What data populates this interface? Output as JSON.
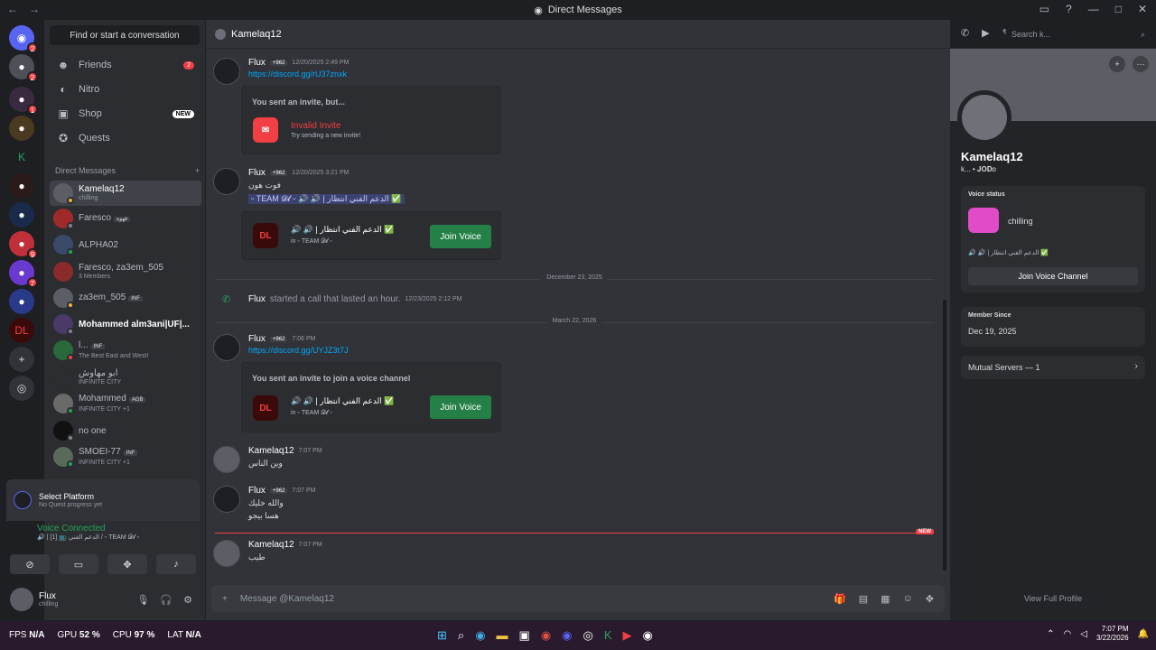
{
  "window": {
    "title": "Direct Messages"
  },
  "sidebar": {
    "find_label": "Find or start a conversation",
    "nav": [
      {
        "label": "Friends",
        "badge": "2"
      },
      {
        "label": "Nitro",
        "badge": ""
      },
      {
        "label": "Shop",
        "badge": "NEW"
      },
      {
        "label": "Quests",
        "badge": ""
      }
    ],
    "dm_header": "Direct Messages",
    "dms": [
      {
        "name": "Kamelaq12",
        "sub": "chilling"
      },
      {
        "name": "Faresco",
        "sub": "",
        "tag": "قهوة"
      },
      {
        "name": "ALPHA02",
        "sub": ""
      },
      {
        "name": "Faresco, za3em_505",
        "sub": "3 Members"
      },
      {
        "name": "za3em_505",
        "sub": "",
        "tag": "INF"
      },
      {
        "name": "Mohammed alm3ani|UF|...",
        "sub": ""
      },
      {
        "name": "l...",
        "sub": "The Best East and West!",
        "tag": "INF"
      },
      {
        "name": "ابو مهاوش",
        "sub": "INFINITE CITY"
      },
      {
        "name": "Mohammed",
        "sub": "INFINITE CITY +1",
        "tag": "AGB"
      },
      {
        "name": "no one",
        "sub": ""
      },
      {
        "name": "SMOEI-77",
        "sub": "INFINITE CITY +1",
        "tag": "INF"
      }
    ],
    "quest": {
      "title": "Select Platform",
      "sub": "No Quest progress yet"
    },
    "voice": {
      "status": "Voice Connected",
      "channel": "🔊 | [1] 📺 الدعم الفني / ᵕ TEAM 𝓓𝓵 ᵕ"
    },
    "user": {
      "name": "Flux",
      "status": "chilling"
    }
  },
  "chat": {
    "recipient": "Kamelaq12",
    "search_placeholder": "Search k...",
    "composer_placeholder": "Message @Kamelaq12",
    "messages": [
      {
        "author": "Flux",
        "badge": "+962",
        "time": "12/20/2025 2:49 PM",
        "link": "https://discord.gg/rU37znxk"
      },
      {
        "author": "Flux",
        "badge": "+962",
        "time": "12/20/2025 3:21 PM",
        "text": "فوت هون",
        "mention": "ᵕ TEAM 𝓓𝓵 ᵕ 🔊 🔊 | الدعم الفني انتظار ✅"
      },
      {
        "author": "Flux",
        "badge": "+962",
        "time": "7:06 PM",
        "link": "https://discord.gg/UYJZ3t7J"
      },
      {
        "author": "Kamelaq12",
        "time": "7:07 PM",
        "text": "وين الناس"
      },
      {
        "author": "Flux",
        "badge": "+962",
        "time": "7:07 PM",
        "text": "والله خليك",
        "text2": "هسا بيجو"
      },
      {
        "author": "Kamelaq12",
        "time": "7:07 PM",
        "text": "طيب"
      }
    ],
    "invalid_invite": {
      "header": "You sent an invite, but...",
      "title": "Invalid Invite",
      "sub": "Try sending a new invite!"
    },
    "voice_invite": {
      "header": "You sent an invite to join a voice channel",
      "channel": "🔊 🔊 | الدعم الفني انتظار ✅",
      "sub": "in ᵕ TEAM 𝓓𝓵 ᵕ",
      "button": "Join Voice"
    },
    "call": {
      "author": "Flux",
      "text": "started a call that lasted an hour.",
      "time": "12/23/2025 2:12 PM"
    },
    "dividers": [
      "December 23, 2025",
      "March 22, 2026"
    ],
    "new_label": "NEW"
  },
  "profile": {
    "name": "Kamelaq12",
    "sub": "k... • 𝐉𝐎𝐃ɒ",
    "voice_status_label": "Voice status",
    "voice_status": "chilling",
    "voice_channel": "🔊 🔊 | الدعم الفني انتظار ✅",
    "join_label": "Join Voice Channel",
    "member_since_label": "Member Since",
    "member_since": "Dec 19, 2025",
    "mutual": "Mutual Servers — 1",
    "view_full": "View Full Profile"
  },
  "taskbar": {
    "fps": "N/A",
    "gpu": "52 %",
    "cpu": "97 %",
    "lat": "N/A",
    "time": "7:07 PM",
    "date": "3/22/2026"
  },
  "colors": {
    "accent": "#5865f2",
    "green": "#248046",
    "red": "#f23f43",
    "link": "#00a8fc"
  }
}
